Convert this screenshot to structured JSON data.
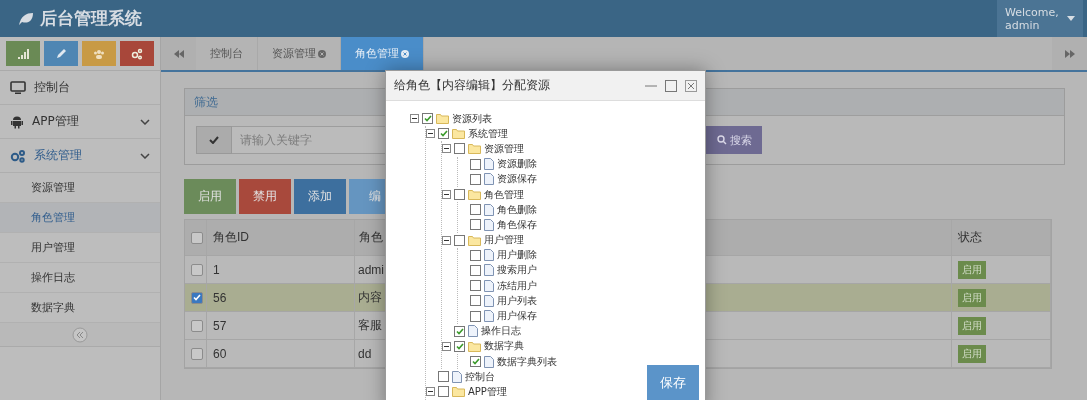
{
  "header": {
    "title": "后台管理系统",
    "welcome": "Welcome,",
    "user": "admin"
  },
  "shortcuts": [
    {
      "kind": "stats",
      "color": "#6a8a55"
    },
    {
      "kind": "edit",
      "color": "#4f86b3"
    },
    {
      "kind": "users",
      "color": "#c89a45"
    },
    {
      "kind": "settings",
      "color": "#a8473a"
    }
  ],
  "sidebar": {
    "items": [
      {
        "label": "控制台",
        "kind": "monitor",
        "selected": false
      },
      {
        "label": "APP管理",
        "kind": "android",
        "selected": false,
        "arrow": true
      },
      {
        "label": "系统管理",
        "kind": "gears",
        "selected": true,
        "arrow": true,
        "children": [
          {
            "label": "资源管理",
            "selected": false
          },
          {
            "label": "角色管理",
            "selected": true
          },
          {
            "label": "用户管理",
            "selected": false
          },
          {
            "label": "操作日志",
            "selected": false
          },
          {
            "label": "数据字典",
            "selected": false
          }
        ]
      }
    ]
  },
  "tabs": [
    {
      "label": "控制台",
      "closable": false,
      "selected": false
    },
    {
      "label": "资源管理",
      "closable": true,
      "selected": false
    },
    {
      "label": "角色管理",
      "closable": true,
      "selected": true
    }
  ],
  "filter": {
    "title": "筛选",
    "placeholder": "请输入关键字",
    "search": "搜索"
  },
  "actions": [
    {
      "label": "启用",
      "color": "#6b8b5a"
    },
    {
      "label": "禁用",
      "color": "#a8493c"
    },
    {
      "label": "添加",
      "color": "#3d6f9e"
    },
    {
      "label": "编",
      "color": "#6595c0"
    }
  ],
  "table": {
    "all_checked": false,
    "columns": [
      "角色ID",
      "角色",
      "状态"
    ],
    "rows": [
      {
        "selected": false,
        "id": "1",
        "name": "admi",
        "status": "启用"
      },
      {
        "selected": true,
        "id": "56",
        "name": "内容",
        "status": "启用"
      },
      {
        "selected": false,
        "id": "57",
        "name": "客服",
        "status": "启用"
      },
      {
        "selected": false,
        "id": "60",
        "name": "dd",
        "status": "启用"
      }
    ]
  },
  "dialog": {
    "title": "给角色【内容编辑】分配资源",
    "save": "保存",
    "tree": [
      {
        "label": "资源列表",
        "kind": "folder",
        "expanded": true,
        "checked": true,
        "children": [
          {
            "label": "系统管理",
            "kind": "folder",
            "expanded": true,
            "checked": true,
            "children": [
              {
                "label": "资源管理",
                "kind": "folder",
                "expanded": true,
                "checked": false,
                "children": [
                  {
                    "label": "资源删除",
                    "kind": "file",
                    "checked": false
                  },
                  {
                    "label": "资源保存",
                    "kind": "file",
                    "checked": false
                  }
                ]
              },
              {
                "label": "角色管理",
                "kind": "folder",
                "expanded": true,
                "checked": false,
                "children": [
                  {
                    "label": "角色删除",
                    "kind": "file",
                    "checked": false
                  },
                  {
                    "label": "角色保存",
                    "kind": "file",
                    "checked": false
                  }
                ]
              },
              {
                "label": "用户管理",
                "kind": "folder",
                "expanded": true,
                "checked": false,
                "children": [
                  {
                    "label": "用户删除",
                    "kind": "file",
                    "checked": false
                  },
                  {
                    "label": "搜索用户",
                    "kind": "file",
                    "checked": false
                  },
                  {
                    "label": "冻结用户",
                    "kind": "file",
                    "checked": false
                  },
                  {
                    "label": "用户列表",
                    "kind": "file",
                    "checked": false
                  },
                  {
                    "label": "用户保存",
                    "kind": "file",
                    "checked": false
                  }
                ]
              },
              {
                "label": "操作日志",
                "kind": "file",
                "checked": true
              },
              {
                "label": "数据字典",
                "kind": "folder",
                "expanded": true,
                "checked": true,
                "children": [
                  {
                    "label": "数据字典列表",
                    "kind": "file",
                    "checked": true
                  }
                ]
              }
            ]
          },
          {
            "label": "控制台",
            "kind": "file",
            "checked": false
          },
          {
            "label": "APP管理",
            "kind": "folder",
            "expanded": true,
            "checked": false
          }
        ]
      }
    ]
  }
}
